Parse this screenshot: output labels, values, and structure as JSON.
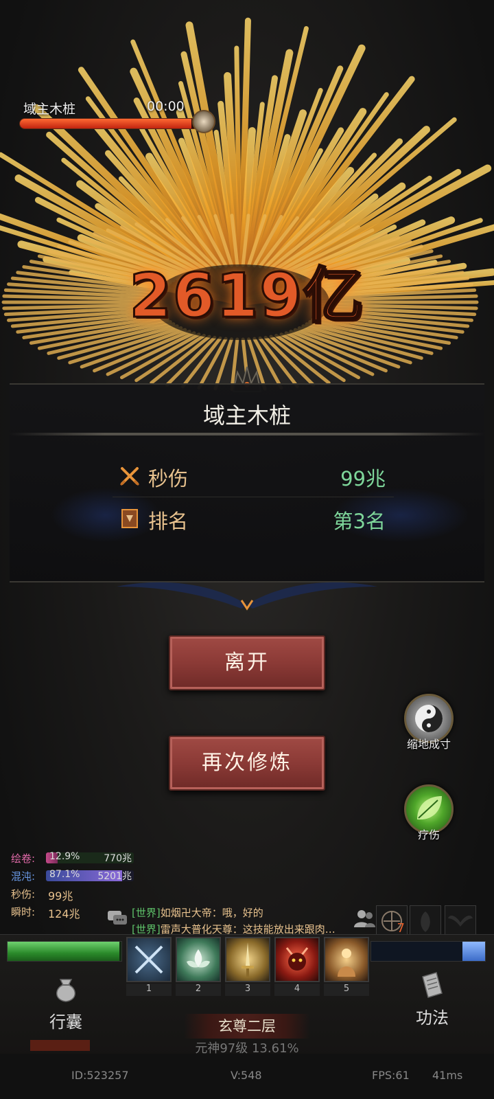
{
  "boss": {
    "name": "域主木桩",
    "timer": "00:00",
    "hp_fraction": 0.96
  },
  "damage_popup": "2619亿",
  "result_panel": {
    "title": "域主木桩",
    "dps_label": "秒伤",
    "dps_value": "99兆",
    "rank_label": "排名",
    "rank_value": "第3名"
  },
  "buttons": {
    "leave": "离开",
    "retrain": "再次修炼"
  },
  "side_skills": {
    "shrink": "缩地成寸",
    "heal": "疗伤"
  },
  "stats_log": {
    "huijuan_label": "绘卷:",
    "huijuan_pct": "12.9%",
    "huijuan_val": "770兆",
    "huijuan_fraction": 0.129,
    "hundun_label": "混沌:",
    "hundun_pct": "87.1%",
    "hundun_val": "5201兆",
    "hundun_fraction": 0.871,
    "dps_label": "秒伤:",
    "dps_val": "99兆",
    "instant_label": "瞬时:",
    "instant_val": "124兆"
  },
  "chat": [
    {
      "channel": "[世界]",
      "text": "如烟卍大帝：哦，好的"
    },
    {
      "channel": "[世界]",
      "text": "雷声大普化天尊：这技能放出来跟肉…"
    }
  ],
  "buffs": {
    "first_count": "7"
  },
  "hud": {
    "hp_fraction": 0.98,
    "mp_fraction": 0.2,
    "skills": [
      "1",
      "2",
      "3",
      "4",
      "5"
    ],
    "bag_label": "行囊",
    "art_label": "功法",
    "realm": "玄尊二层",
    "exp_text": "元神97级  13.61%",
    "exp_fraction": 0.1361
  },
  "footer": {
    "id": "ID:523257",
    "version": "V:548",
    "fps": "FPS:61",
    "latency": "41ms"
  },
  "colors": {
    "damage_orange": "#e25a28",
    "value_green": "#7ed69a",
    "label_gold": "#e8c28e",
    "button_red": "#8b3a36",
    "chat_channel": "#5fc36a"
  }
}
